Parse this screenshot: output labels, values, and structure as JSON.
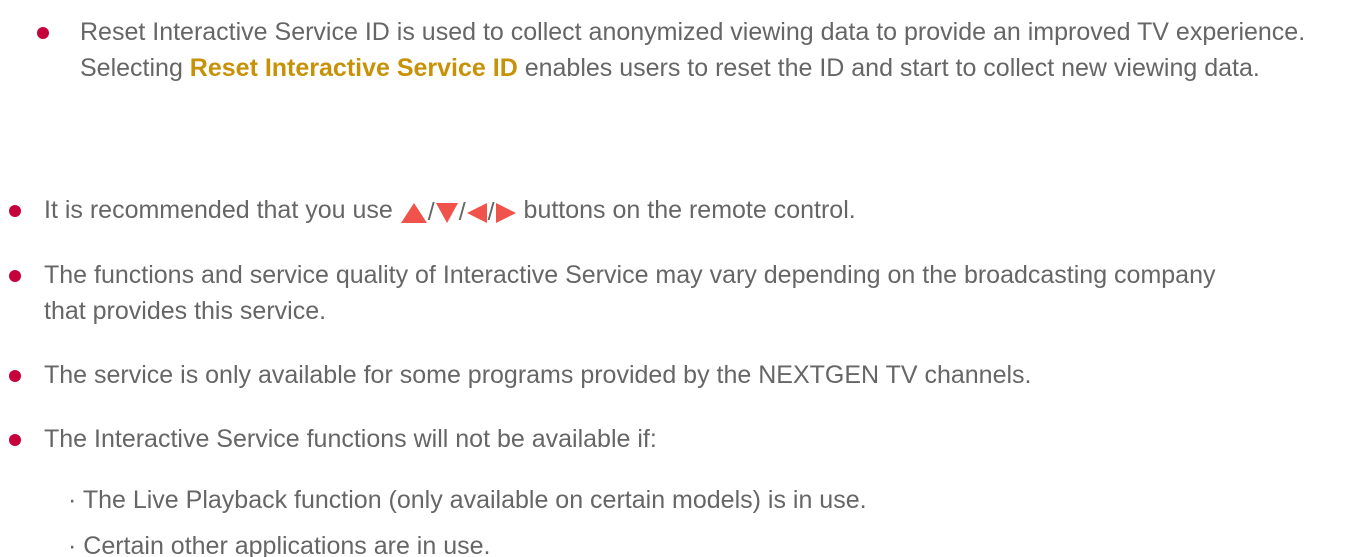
{
  "colors": {
    "bullet": "#c6023c",
    "text": "#666666",
    "highlight": "#c79208",
    "arrow": "#f0524c"
  },
  "items": {
    "reset": {
      "text_before": "Reset Interactive Service ID is used to collect anonymized viewing data to provide an improved TV experience. Selecting ",
      "highlight": "Reset Interactive Service ID",
      "text_after": " enables users to reset the ID and start to collect new viewing data."
    },
    "recommend": {
      "text_before": "It is recommended that you use ",
      "separator": "/",
      "text_after": " buttons on the remote control.",
      "icons": [
        "up-arrow-icon",
        "down-arrow-icon",
        "left-arrow-icon",
        "right-arrow-icon"
      ]
    },
    "functions": {
      "text": "The functions and service quality of Interactive Service may vary depending on the broadcasting company that provides this service."
    },
    "availability": {
      "text": "The service is only available for some programs provided by the NEXTGEN TV channels."
    },
    "not_available": {
      "text": "The Interactive Service functions will not be available if:"
    },
    "sub_items": [
      "· The Live Playback function (only available on certain models) is in use.",
      "· Certain other applications are in use."
    ]
  }
}
